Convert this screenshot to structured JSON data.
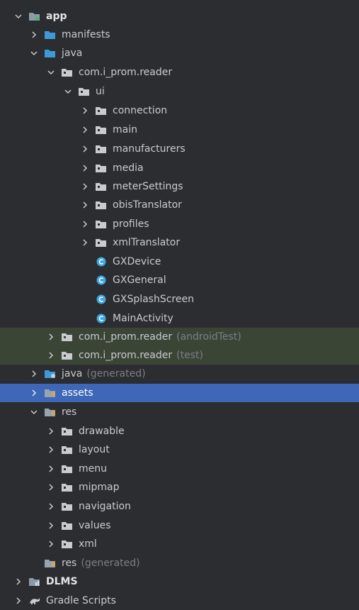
{
  "colors": {
    "background": "#2b2d30",
    "selection": "#3f67b8",
    "test_highlight": "#3b4536",
    "folder_blue": "#3d9ad8",
    "folder_gray": "#c9cbcf",
    "class_icon": "#3fa7e3"
  },
  "tree": {
    "app": "app",
    "manifests": "manifests",
    "java": "java",
    "package_main": "com.i_prom.reader",
    "ui": "ui",
    "connection": "connection",
    "main": "main",
    "manufacturers": "manufacturers",
    "media": "media",
    "meter_settings": "meterSettings",
    "obis_translator": "obisTranslator",
    "profiles": "profiles",
    "xml_translator": "xmlTranslator",
    "gx_device": "GXDevice",
    "gx_general": "GXGeneral",
    "gx_splash": "GXSplashScreen",
    "main_activity": "MainActivity",
    "package_android_test": "com.i_prom.reader",
    "android_test_suffix": "(androidTest)",
    "package_test": "com.i_prom.reader",
    "test_suffix": "(test)",
    "java_generated": "java",
    "generated_suffix": "(generated)",
    "assets": "assets",
    "res": "res",
    "drawable": "drawable",
    "layout": "layout",
    "menu": "menu",
    "mipmap": "mipmap",
    "navigation": "navigation",
    "values": "values",
    "xml": "xml",
    "res_generated": "res",
    "res_generated_suffix": "(generated)",
    "dlms": "DLMS",
    "gradle_scripts": "Gradle Scripts"
  },
  "icons": {
    "expanded": "chevron-down-icon",
    "collapsed": "chevron-right-icon",
    "module": "module-folder-icon",
    "folder": "folder-icon",
    "package": "package-icon",
    "class": "class-icon",
    "resources": "resources-folder-icon",
    "gradle": "gradle-icon"
  }
}
